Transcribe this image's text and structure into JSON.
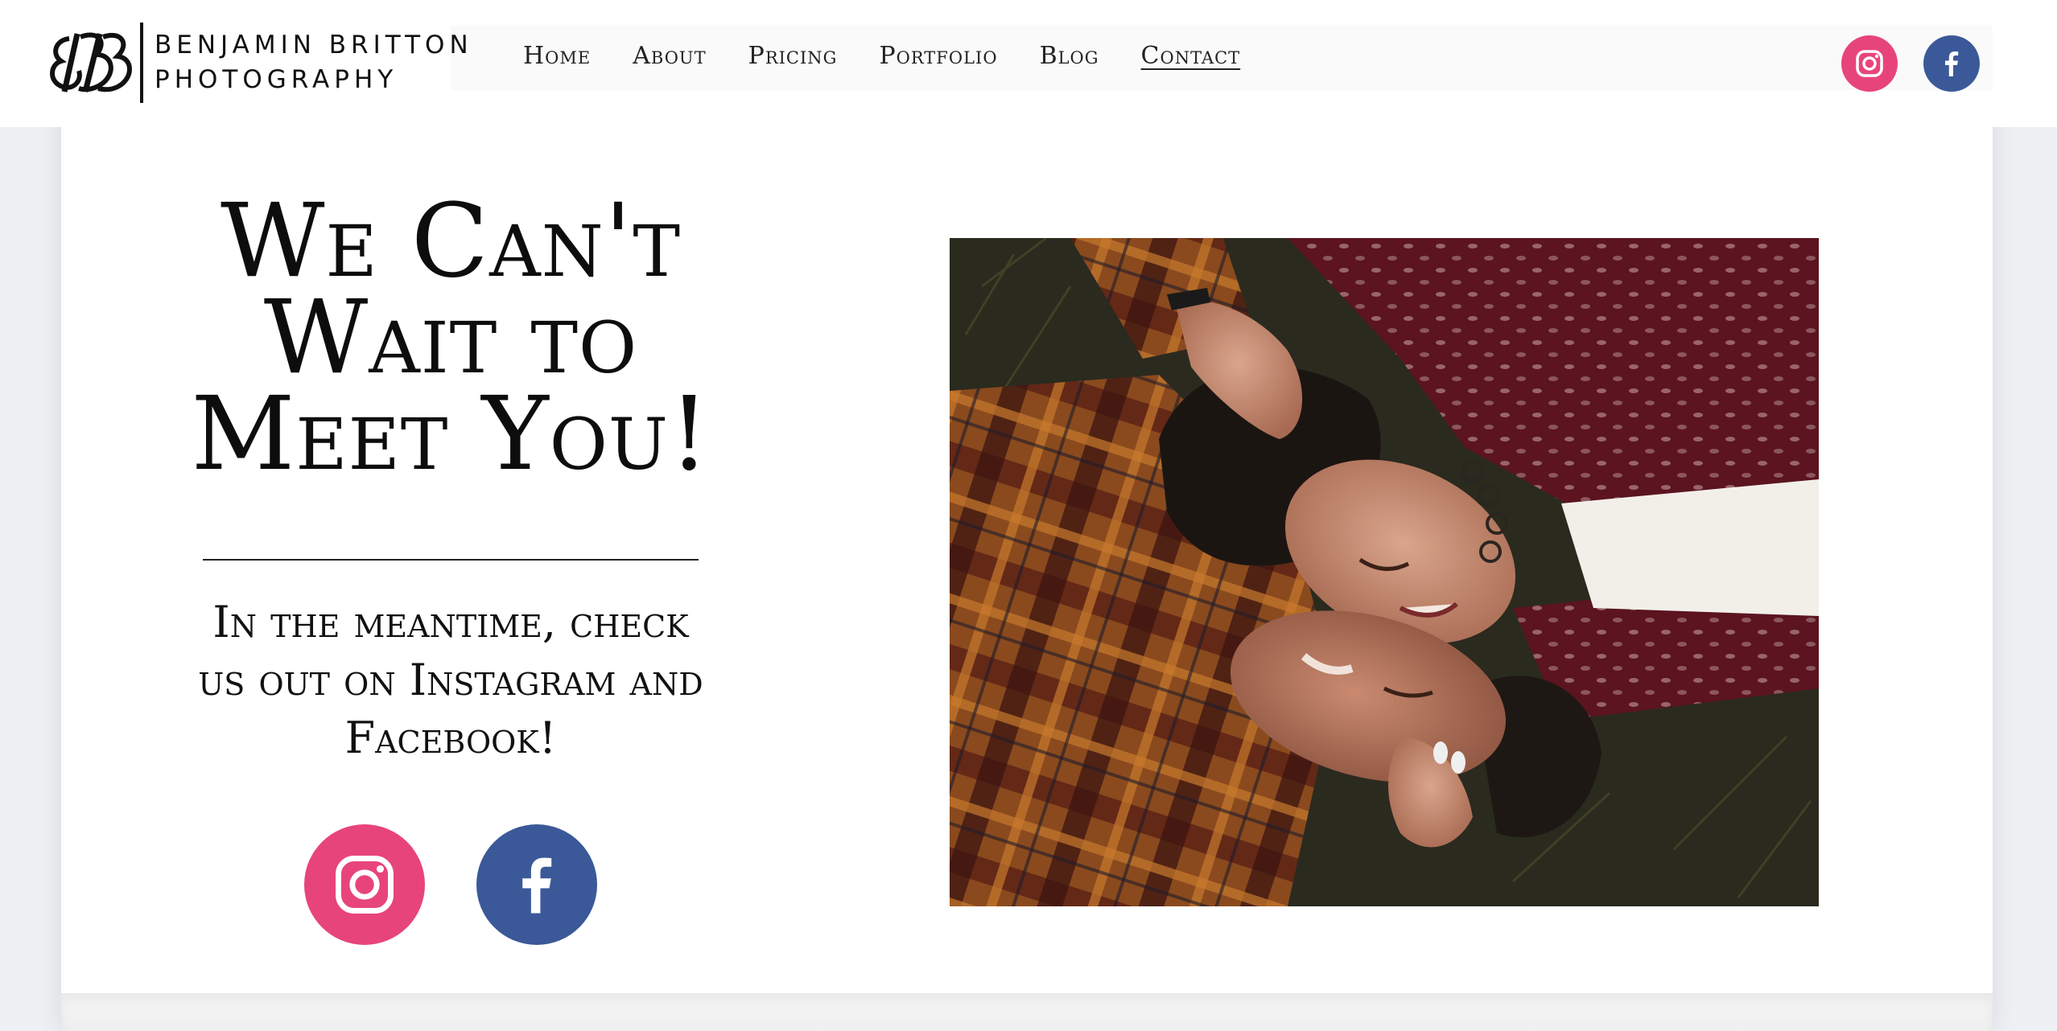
{
  "brand": {
    "name_line1": "BENJAMIN BRITTON",
    "name_line2": "PHOTOGRAPHY",
    "logo_icon": "bb-monogram-logo"
  },
  "nav": {
    "items": [
      {
        "label": "Home"
      },
      {
        "label": "About"
      },
      {
        "label": "Pricing"
      },
      {
        "label": "Portfolio"
      },
      {
        "label": "Blog"
      },
      {
        "label": "Contact",
        "active": true
      }
    ]
  },
  "header_social": {
    "instagram_icon": "instagram-icon",
    "facebook_icon": "facebook-icon"
  },
  "hero": {
    "headline_line1": "We Can't",
    "headline_line2": "Wait to",
    "headline_line3": "Meet You!",
    "subtext_line1": "In the meantime, check",
    "subtext_line2": "us out on Instagram and",
    "subtext_line3": "Facebook!"
  },
  "colors": {
    "instagram": "#e8447c",
    "facebook": "#3b5998",
    "text": "#111111",
    "background": "#ffffff"
  }
}
